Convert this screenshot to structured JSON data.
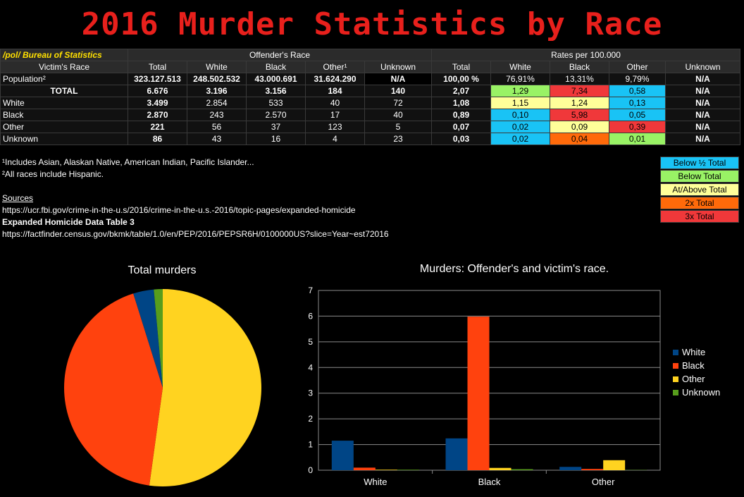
{
  "title": "2016 Murder Statistics by Race",
  "table": {
    "brand": "/pol/ Bureau of Statistics",
    "group_offender": "Offender's Race",
    "group_rates": "Rates per 100.000",
    "victim_header": "Victim's Race",
    "columns": [
      "Total",
      "White",
      "Black",
      "Other¹",
      "Unknown",
      "Total",
      "White",
      "Black",
      "Other",
      "Unknown"
    ],
    "rows": [
      {
        "label": "Population²",
        "cells": [
          "323.127.513",
          "248.502.532",
          "43.000.691",
          "31.624.290",
          "N/A",
          "100,00 %",
          "76,91%",
          "13,31%",
          "9,79%",
          "N/A"
        ]
      },
      {
        "label": "TOTAL",
        "cells": [
          "6.676",
          "3.196",
          "3.156",
          "184",
          "140",
          "2,07",
          "1,29",
          "7,34",
          "0,58",
          "N/A"
        ]
      },
      {
        "label": "White",
        "cells": [
          "3.499",
          "2.854",
          "533",
          "40",
          "72",
          "1,08",
          "1,15",
          "1,24",
          "0,13",
          "N/A"
        ]
      },
      {
        "label": "Black",
        "cells": [
          "2.870",
          "243",
          "2.570",
          "17",
          "40",
          "0,89",
          "0,10",
          "5,98",
          "0,05",
          "N/A"
        ]
      },
      {
        "label": "Other",
        "cells": [
          "221",
          "56",
          "37",
          "123",
          "5",
          "0,07",
          "0,02",
          "0,09",
          "0,39",
          "N/A"
        ]
      },
      {
        "label": "Unknown",
        "cells": [
          "86",
          "43",
          "16",
          "4",
          "23",
          "0,03",
          "0,02",
          "0,04",
          "0,01",
          "N/A"
        ]
      }
    ]
  },
  "notes": {
    "note1": "¹Includes Asian, Alaskan Native, American Indian, Pacific Islander...",
    "note2": "²All races include Hispanic.",
    "sources_label": "Sources",
    "source1": "https://ucr.fbi.gov/crime-in-the-u.s/2016/crime-in-the-u.s.-2016/topic-pages/expanded-homicide",
    "source1_title": "Expanded Homicide Data Table 3",
    "source2": "https://factfinder.census.gov/bkmk/table/1.0/en/PEP/2016/PEPSR6H/0100000US?slice=Year~est72016"
  },
  "color_legend": [
    {
      "label": "Below ½ Total",
      "color": "#19c3f5"
    },
    {
      "label": "Below Total",
      "color": "#99f265"
    },
    {
      "label": "At/Above Total",
      "color": "#ffff99"
    },
    {
      "label": "2x Total",
      "color": "#ff6a0a"
    },
    {
      "label": "3x Total",
      "color": "#f0383a"
    }
  ],
  "chart_data": [
    {
      "type": "pie",
      "title": "Total murders",
      "slices": [
        {
          "value": 1.08,
          "color": "#ffd320"
        },
        {
          "value": 0.89,
          "color": "#ff420e"
        },
        {
          "value": 0.07,
          "color": "#004586"
        },
        {
          "value": 0.03,
          "color": "#579d1c"
        }
      ]
    },
    {
      "type": "bar",
      "title": "Murders: Offender's and victim's race.",
      "categories": [
        "White",
        "Black",
        "Other"
      ],
      "ylim": [
        0,
        7
      ],
      "yticks": [
        0,
        1,
        2,
        3,
        4,
        5,
        6,
        7
      ],
      "grid": true,
      "legend_position": "right",
      "series": [
        {
          "name": "White",
          "color": "#004586",
          "values": [
            1.15,
            1.24,
            0.13
          ]
        },
        {
          "name": "Black",
          "color": "#ff420e",
          "values": [
            0.1,
            5.98,
            0.05
          ]
        },
        {
          "name": "Other",
          "color": "#ffd320",
          "values": [
            0.02,
            0.09,
            0.39
          ]
        },
        {
          "name": "Unknown",
          "color": "#579d1c",
          "values": [
            0.02,
            0.04,
            0.01
          ]
        }
      ]
    }
  ]
}
